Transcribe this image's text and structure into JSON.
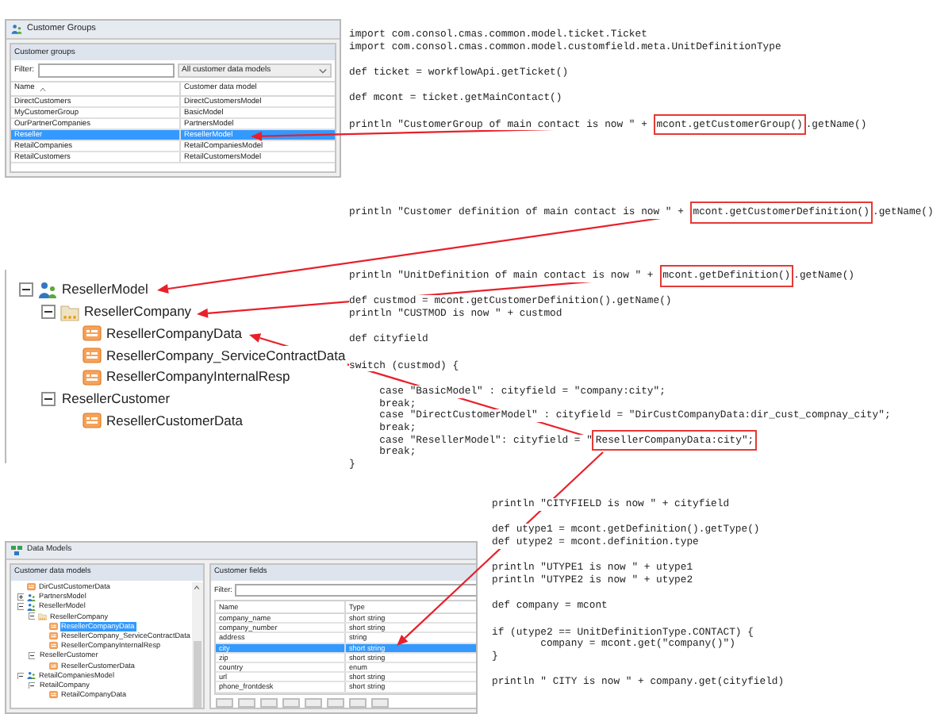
{
  "customer_groups_window": {
    "title": "Customer Groups",
    "panel_title": "Customer groups",
    "filter_label": "Filter:",
    "model_filter": "All customer data models",
    "columns": [
      "Name",
      "Customer data model"
    ],
    "rows": [
      {
        "name": "DirectCustomers",
        "model": "DirectCustomersModel",
        "selected": false
      },
      {
        "name": "MyCustomerGroup",
        "model": "BasicModel",
        "selected": false
      },
      {
        "name": "OurPartnerCompanies",
        "model": "PartnersModel",
        "selected": false
      },
      {
        "name": "Reseller",
        "model": "ResellerModel",
        "selected": true
      },
      {
        "name": "RetailCompanies",
        "model": "RetailCompaniesModel",
        "selected": false
      },
      {
        "name": "RetailCustomers",
        "model": "RetailCustomersModel",
        "selected": false
      }
    ]
  },
  "model_tree": [
    {
      "label": "ResellerModel",
      "kind": "model",
      "expanded": true,
      "children": [
        {
          "label": "ResellerCompany",
          "kind": "group",
          "expanded": true,
          "children": [
            {
              "label": "ResellerCompanyData",
              "kind": "data"
            },
            {
              "label": "ResellerCompany_ServiceContractData",
              "kind": "data"
            },
            {
              "label": "ResellerCompanyInternalResp",
              "kind": "data"
            }
          ]
        },
        {
          "label": "ResellerCustomer",
          "kind": "plain",
          "expanded": true,
          "children": [
            {
              "label": "ResellerCustomerData",
              "kind": "data"
            }
          ]
        }
      ]
    }
  ],
  "code_blocks": [
    {
      "paragraphs": [
        [
          [
            {
              "text": "import com.consol.cmas.common.model.ticket.Ticket",
              "boxed": false
            }
          ],
          [
            {
              "text": "import com.consol.cmas.common.model.customfield.meta.UnitDefinitionType",
              "boxed": false
            }
          ]
        ],
        [
          [
            {
              "text": "def ticket = workflowApi.getTicket()",
              "boxed": false
            }
          ]
        ],
        [
          [
            {
              "text": "def mcont = ticket.getMainContact()",
              "boxed": false
            }
          ]
        ],
        [
          [
            {
              "text": "println \"CustomerGroup of main contact is now \" + ",
              "boxed": false
            },
            {
              "text": "mcont.getCustomerGroup()",
              "boxed": true
            },
            {
              "text": ".getName()",
              "boxed": false
            }
          ]
        ]
      ]
    },
    {
      "paragraphs": [
        [
          [
            {
              "text": "println \"Customer definition of main contact is now \" + ",
              "boxed": false
            },
            {
              "text": "mcont.getCustomerDefinition()",
              "boxed": true
            },
            {
              "text": ".getName()",
              "boxed": false
            }
          ]
        ]
      ]
    },
    {
      "paragraphs": [
        [
          [
            {
              "text": "println \"UnitDefinition of main contact is now \" + ",
              "boxed": false
            },
            {
              "text": "mcont.getDefinition()",
              "boxed": true
            },
            {
              "text": ".getName()",
              "boxed": false
            }
          ]
        ],
        [
          [
            {
              "text": "def custmod = mcont.getCustomerDefinition().getName()",
              "boxed": false
            }
          ],
          [
            {
              "text": "println \"CUSTMOD is now \" + custmod",
              "boxed": false
            }
          ]
        ],
        [
          [
            {
              "text": "def cityfield",
              "boxed": false
            }
          ]
        ],
        [
          [
            {
              "text": "switch (custmod) {",
              "boxed": false
            }
          ]
        ],
        [
          [
            {
              "text": "     case \"BasicModel\" : cityfield = \"company:city\";",
              "boxed": false
            }
          ],
          [
            {
              "text": "     break;",
              "boxed": false
            }
          ],
          [
            {
              "text": "     case \"DirectCustomerModel\" : cityfield = \"DirCustCompanyData:dir_cust_compnay_city\";",
              "boxed": false
            }
          ],
          [
            {
              "text": "     break;",
              "boxed": false
            }
          ],
          [
            {
              "text": "     case \"ResellerModel\": cityfield = \"",
              "boxed": false
            },
            {
              "text": "ResellerCompanyData:city\";",
              "boxed": true
            }
          ],
          [
            {
              "text": "     break;",
              "boxed": false
            }
          ],
          [
            {
              "text": "}",
              "boxed": false
            }
          ]
        ]
      ]
    },
    {
      "paragraphs": [
        [
          [
            {
              "text": "println \"CITYFIELD is now \" + cityfield",
              "boxed": false
            }
          ]
        ],
        [
          [
            {
              "text": "def utype1 = mcont.getDefinition().getType()",
              "boxed": false
            }
          ],
          [
            {
              "text": "def utype2 = mcont.definition.type",
              "boxed": false
            }
          ]
        ],
        [
          [
            {
              "text": "println \"UTYPE1 is now \" + utype1",
              "boxed": false
            }
          ],
          [
            {
              "text": "println \"UTYPE2 is now \" + utype2",
              "boxed": false
            }
          ]
        ],
        [
          [
            {
              "text": "def company = mcont",
              "boxed": false
            }
          ]
        ],
        [
          [
            {
              "text": "if (utype2 == UnitDefinitionType.CONTACT) {",
              "boxed": false
            }
          ],
          [
            {
              "text": "        company = mcont.get(\"company()\")",
              "boxed": false
            }
          ],
          [
            {
              "text": "}",
              "boxed": false
            }
          ]
        ],
        [
          [
            {
              "text": "println \" CITY is now \" + company.get(cityfield)",
              "boxed": false
            }
          ]
        ]
      ]
    }
  ],
  "data_models_window": {
    "title": "Data Models",
    "models_panel": {
      "title": "Customer data models",
      "tree": [
        {
          "label": "DirCustCustomerData",
          "kind": "data",
          "selected": false
        },
        {
          "label": "PartnersModel",
          "kind": "model",
          "expanded": false,
          "selected": false
        },
        {
          "label": "ResellerModel",
          "kind": "model",
          "expanded": true,
          "selected": false,
          "children": [
            {
              "label": "ResellerCompany",
              "kind": "group",
              "expanded": true,
              "selected": false,
              "children": [
                {
                  "label": "ResellerCompanyData",
                  "kind": "data",
                  "selected": true
                },
                {
                  "label": "ResellerCompany_ServiceContractData",
                  "kind": "data",
                  "selected": false
                },
                {
                  "label": "ResellerCompanyInternalResp",
                  "kind": "data",
                  "selected": false
                }
              ]
            },
            {
              "label": "ResellerCustomer",
              "kind": "plain",
              "expanded": true,
              "selected": false,
              "children": [
                {
                  "label": "ResellerCustomerData",
                  "kind": "data",
                  "selected": false
                }
              ]
            }
          ]
        },
        {
          "label": "RetailCompaniesModel",
          "kind": "model",
          "expanded": true,
          "selected": false,
          "children": [
            {
              "label": "RetailCompany",
              "kind": "plain",
              "expanded": true,
              "selected": false,
              "children": [
                {
                  "label": "RetailCompanyData",
                  "kind": "data",
                  "selected": false
                }
              ]
            }
          ]
        }
      ]
    },
    "fields_panel": {
      "title": "Customer fields",
      "filter_label": "Filter:",
      "columns": [
        "Name",
        "Type"
      ],
      "rows": [
        {
          "name": "company_name",
          "type": "short string",
          "selected": false
        },
        {
          "name": "company_number",
          "type": "short string",
          "selected": false
        },
        {
          "name": "address",
          "type": "string",
          "selected": false
        },
        {
          "name": "city",
          "type": "short string",
          "selected": true
        },
        {
          "name": "zip",
          "type": "short string",
          "selected": false
        },
        {
          "name": "country",
          "type": "enum",
          "selected": false
        },
        {
          "name": "url",
          "type": "short string",
          "selected": false
        },
        {
          "name": "phone_frontdesk",
          "type": "short string",
          "selected": false
        }
      ]
    }
  }
}
